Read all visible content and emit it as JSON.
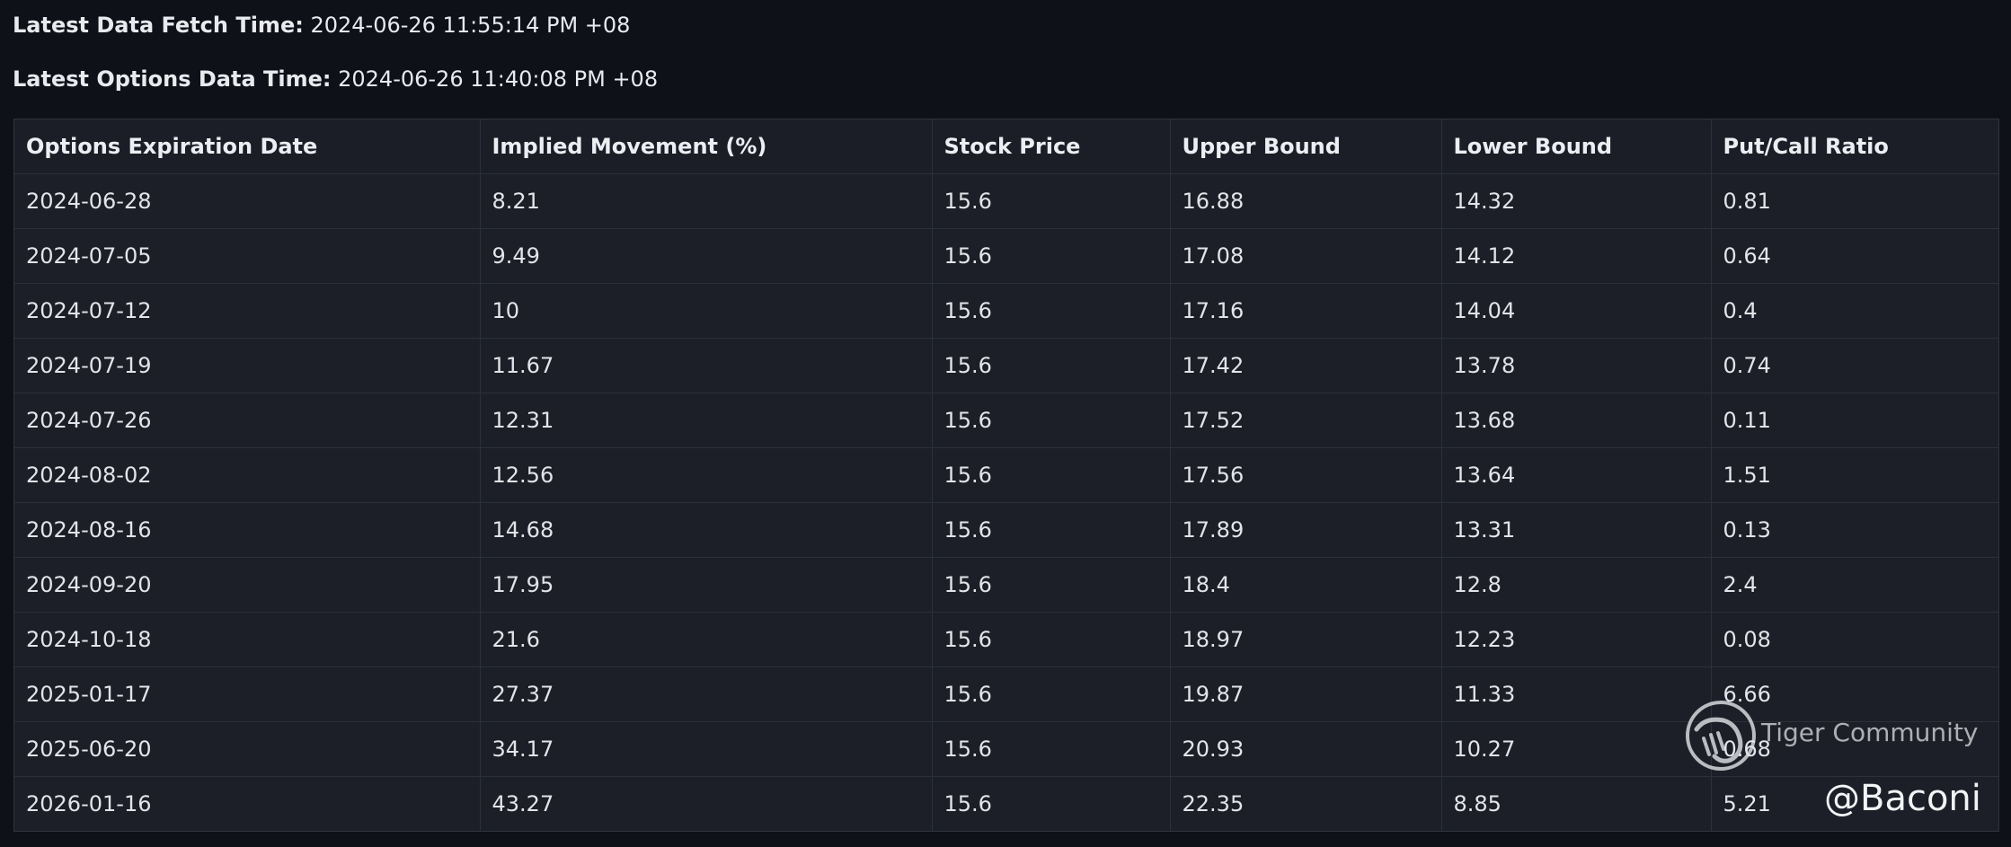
{
  "meta": {
    "fetch_label": "Latest Data Fetch Time:",
    "fetch_value": "2024-06-26 11:55:14 PM +08",
    "options_label": "Latest Options Data Time:",
    "options_value": "2024-06-26 11:40:08 PM +08"
  },
  "table": {
    "headers": [
      "Options Expiration Date",
      "Implied Movement (%)",
      "Stock Price",
      "Upper Bound",
      "Lower Bound",
      "Put/Call Ratio"
    ],
    "rows": [
      [
        "2024-06-28",
        "8.21",
        "15.6",
        "16.88",
        "14.32",
        "0.81"
      ],
      [
        "2024-07-05",
        "9.49",
        "15.6",
        "17.08",
        "14.12",
        "0.64"
      ],
      [
        "2024-07-12",
        "10",
        "15.6",
        "17.16",
        "14.04",
        "0.4"
      ],
      [
        "2024-07-19",
        "11.67",
        "15.6",
        "17.42",
        "13.78",
        "0.74"
      ],
      [
        "2024-07-26",
        "12.31",
        "15.6",
        "17.52",
        "13.68",
        "0.11"
      ],
      [
        "2024-08-02",
        "12.56",
        "15.6",
        "17.56",
        "13.64",
        "1.51"
      ],
      [
        "2024-08-16",
        "14.68",
        "15.6",
        "17.89",
        "13.31",
        "0.13"
      ],
      [
        "2024-09-20",
        "17.95",
        "15.6",
        "18.4",
        "12.8",
        "2.4"
      ],
      [
        "2024-10-18",
        "21.6",
        "15.6",
        "18.97",
        "12.23",
        "0.08"
      ],
      [
        "2025-01-17",
        "27.37",
        "15.6",
        "19.87",
        "11.33",
        "6.66"
      ],
      [
        "2025-06-20",
        "34.17",
        "15.6",
        "20.93",
        "10.27",
        "0.68"
      ],
      [
        "2026-01-16",
        "43.27",
        "15.6",
        "22.35",
        "8.85",
        "5.21"
      ]
    ]
  },
  "watermark": {
    "brand": "Tiger Community",
    "handle": "@Baconi",
    "logo_icon": "tiger-logo-icon"
  },
  "colors": {
    "background": "#0e1117",
    "table_bg": "#1c1f27",
    "border": "#2c3038",
    "text": "#e1e4e9"
  }
}
